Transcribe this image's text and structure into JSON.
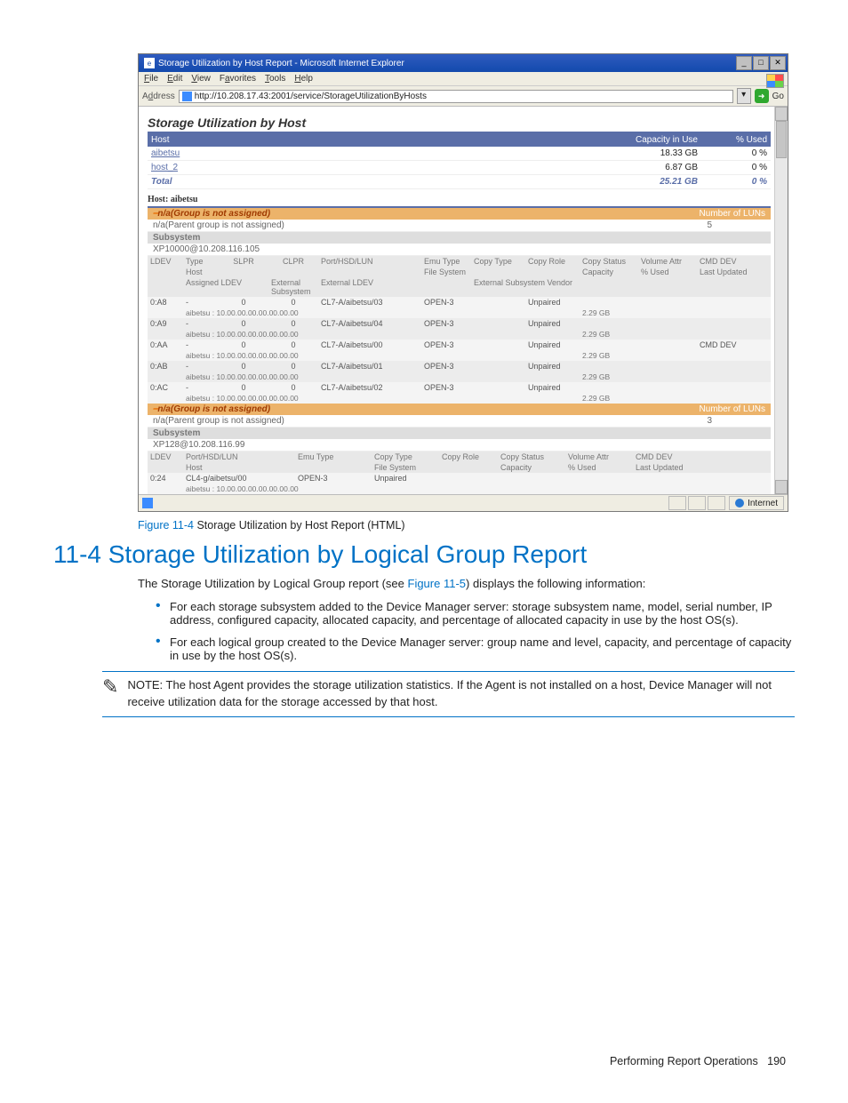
{
  "browser": {
    "title": "Storage Utilization by Host Report - Microsoft Internet Explorer",
    "menu": {
      "file": "File",
      "edit": "Edit",
      "view": "View",
      "favorites": "Favorites",
      "tools": "Tools",
      "help": "Help"
    },
    "address_label": "Address",
    "url": "http://10.208.17.43:2001/service/StorageUtilizationByHosts",
    "go": "Go",
    "status_zone": "Internet"
  },
  "report": {
    "title": "Storage Utilization by Host",
    "columns": {
      "host": "Host",
      "cap": "Capacity in Use",
      "used": "% Used"
    },
    "rows": [
      {
        "host": "aibetsu",
        "cap": "18.33 GB",
        "used": "0 %"
      },
      {
        "host": "host_2",
        "cap": "6.87 GB",
        "used": "0 %"
      }
    ],
    "total": {
      "label": "Total",
      "cap": "25.21 GB",
      "used": "0 %"
    }
  },
  "host1": {
    "header": "Host: aibetsu",
    "grp_label": "n/a(Group is not assigned)",
    "numluns_label": "Number of LUNs",
    "parent": "n/a(Parent group is not assigned)",
    "numluns": "5",
    "subsystem_head": "Subsystem",
    "subsystem": "XP10000@10.208.116.105",
    "hdr": {
      "ldev": "LDEV",
      "type": "Type",
      "slpr": "SLPR",
      "clpr": "CLPR",
      "port": "Port/HSD/LUN",
      "emu": "Emu Type",
      "ctype": "Copy Type",
      "crole": "Copy Role",
      "cstatus": "Copy Status",
      "vattr": "Volume Attr",
      "cmddev": "CMD DEV",
      "host": "Host",
      "assigned": "Assigned LDEV",
      "extsub": "External Subsystem",
      "extldev": "External LDEV",
      "fs": "File System",
      "extvendor": "External Subsystem Vendor",
      "capacity": "Capacity",
      "pused": "% Used",
      "updated": "Last Updated"
    },
    "rows": [
      {
        "ldev": "0:A8",
        "port": "CL7-A/aibetsu/03",
        "emu": "OPEN-3",
        "cstatus": "Unpaired",
        "cap": "2.29 GB",
        "cmd": "",
        "sub": "aibetsu : 10.00.00.00.00.00.00.00"
      },
      {
        "ldev": "0:A9",
        "port": "CL7-A/aibetsu/04",
        "emu": "OPEN-3",
        "cstatus": "Unpaired",
        "cap": "2.29 GB",
        "cmd": "",
        "sub": "aibetsu : 10.00.00.00.00.00.00.00"
      },
      {
        "ldev": "0:AA",
        "port": "CL7-A/aibetsu/00",
        "emu": "OPEN-3",
        "cstatus": "Unpaired",
        "cap": "2.29 GB",
        "cmd": "CMD DEV",
        "sub": "aibetsu : 10.00.00.00.00.00.00.00"
      },
      {
        "ldev": "0:AB",
        "port": "CL7-A/aibetsu/01",
        "emu": "OPEN-3",
        "cstatus": "Unpaired",
        "cap": "2.29 GB",
        "cmd": "",
        "sub": "aibetsu : 10.00.00.00.00.00.00.00"
      },
      {
        "ldev": "0:AC",
        "port": "CL7-A/aibetsu/02",
        "emu": "OPEN-3",
        "cstatus": "Unpaired",
        "cap": "2.29 GB",
        "cmd": "",
        "sub": "aibetsu : 10.00.00.00.00.00.00.00"
      }
    ]
  },
  "host2": {
    "grp_label": "n/a(Group is not assigned)",
    "numluns_label": "Number of LUNs",
    "parent": "n/a(Parent group is not assigned)",
    "numluns": "3",
    "subsystem_head": "Subsystem",
    "subsystem": "XP128@10.208.116.99",
    "hdr": {
      "ldev": "LDEV",
      "port": "Port/HSD/LUN",
      "emu": "Emu Type",
      "ctype": "Copy Type",
      "crole": "Copy Role",
      "cstatus": "Copy Status",
      "vattr": "Volume Attr",
      "cmddev": "CMD DEV",
      "host": "Host",
      "fs": "File System",
      "capacity": "Capacity",
      "pused": "% Used",
      "updated": "Last Updated"
    },
    "row": {
      "ldev": "0:24",
      "port": "CL4-g/aibetsu/00",
      "emu": "OPEN-3",
      "cstatus": "Unpaired",
      "sub": "aibetsu : 10.00.00.00.00.00.00.00"
    }
  },
  "caption": {
    "label": "Figure 11-4",
    "text": " Storage Utilization by Host Report (HTML)"
  },
  "section": {
    "heading": "11-4 Storage Utilization by Logical Group Report",
    "intro_a": "The Storage Utilization by Logical Group report (see ",
    "intro_link": "Figure 11-5",
    "intro_b": ") displays the following information:",
    "bullet1": "For each storage subsystem added to the Device Manager server:   storage subsystem name, model, serial number, IP address, configured capacity, allocated capacity, and percentage of allocated capacity in use by the host OS(s).",
    "bullet2": "For each logical group created to the Device Manager server:  group name and level, capacity, and percentage of capacity in use by the host OS(s).",
    "note_label": "NOTE:",
    "note_text": "  The host Agent provides the storage utilization statistics. If the Agent is not installed on a host, Device Manager will not receive utilization data for the storage accessed by that host."
  },
  "footer": {
    "section": "Performing Report Operations",
    "page": "190"
  }
}
